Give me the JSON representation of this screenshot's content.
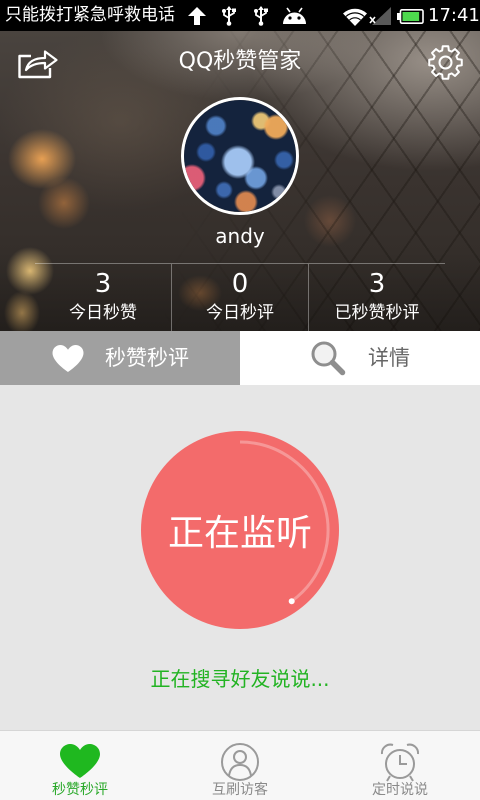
{
  "status_bar": {
    "notice": "只能拨打紧急呼救电话",
    "time": "17:41",
    "battery_level": 0.9,
    "icons": [
      "upload-arrow-icon",
      "usb-icon",
      "usb-icon",
      "android-icon",
      "wifi-icon",
      "signal-icon",
      "battery-icon"
    ]
  },
  "header": {
    "title": "QQ秒赞管家",
    "left_icon": "share-icon",
    "right_icon": "gear-icon",
    "username": "andy"
  },
  "stats": [
    {
      "value": "3",
      "label": "今日秒赞"
    },
    {
      "value": "0",
      "label": "今日秒评"
    },
    {
      "value": "3",
      "label": "已秒赞秒评"
    }
  ],
  "tabs": [
    {
      "label": "秒赞秒评",
      "icon": "heart-icon",
      "active": true
    },
    {
      "label": "详情",
      "icon": "search-icon",
      "active": false
    }
  ],
  "monitor": {
    "button_label": "正在监听",
    "status_text": "正在搜寻好友说说..."
  },
  "bottom_nav": [
    {
      "label": "秒赞秒评",
      "icon": "heart-icon",
      "active": true
    },
    {
      "label": "互刷访客",
      "icon": "person-icon",
      "active": false
    },
    {
      "label": "定时说说",
      "icon": "alarm-clock-icon",
      "active": false
    }
  ],
  "colors": {
    "accent_green": "#22b322",
    "monitor_red": "#f36b6b",
    "tab_active_bg": "#a0a0a0",
    "content_bg": "#e6e6e6"
  }
}
